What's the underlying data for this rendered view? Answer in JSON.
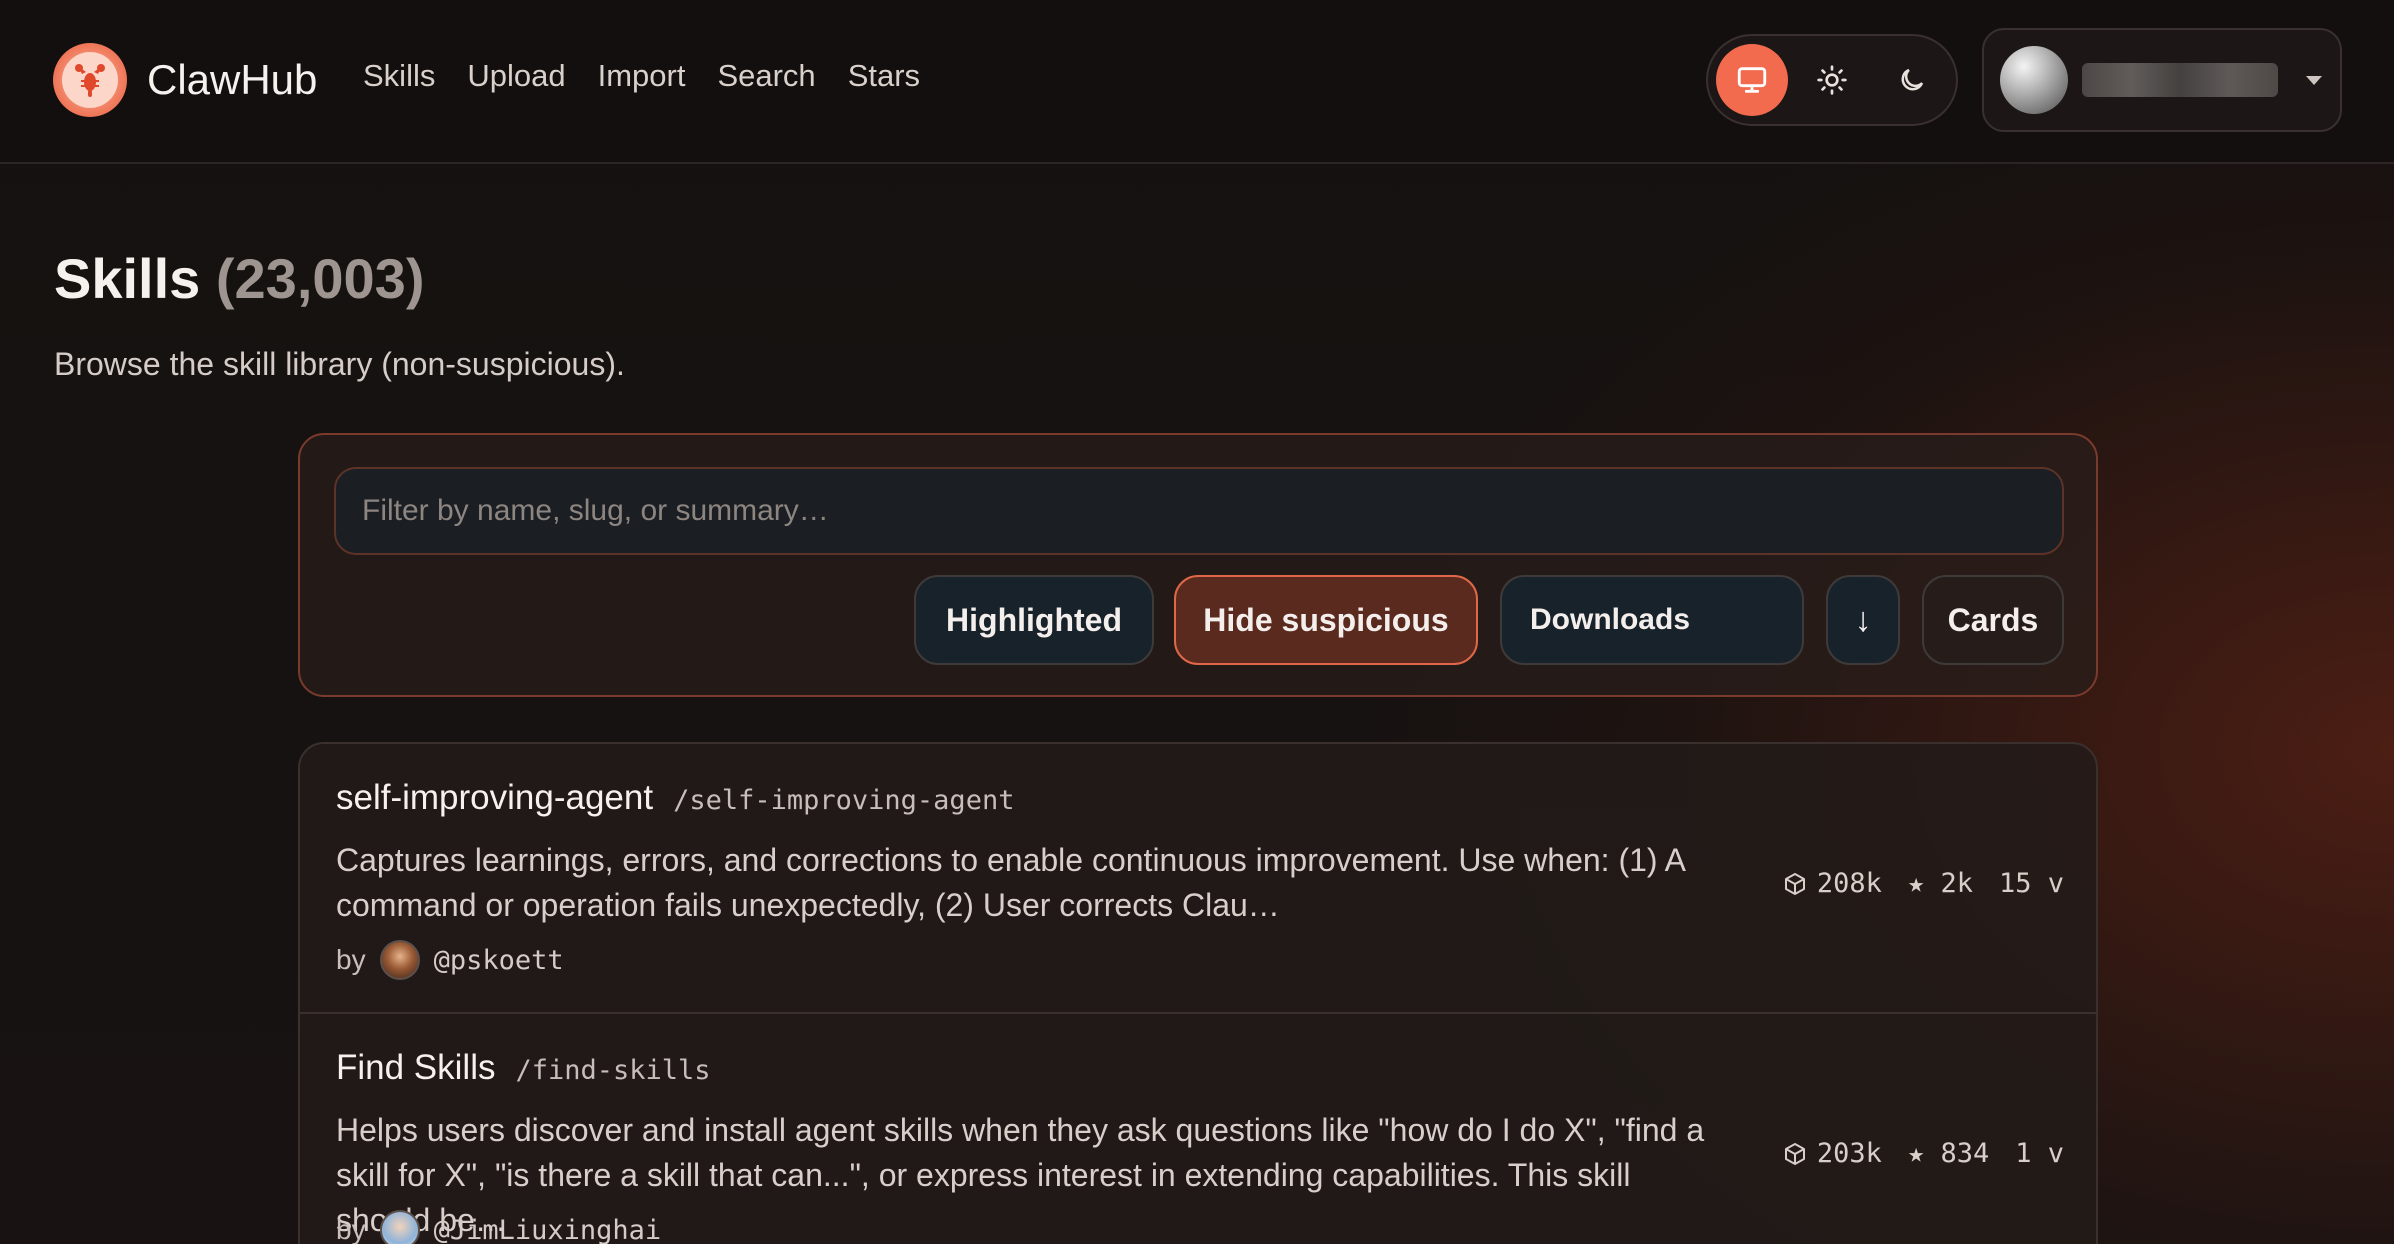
{
  "header": {
    "brand": "ClawHub",
    "nav": [
      "Skills",
      "Upload",
      "Import",
      "Search",
      "Stars"
    ],
    "theme_options": [
      "monitor-icon",
      "sun-icon",
      "moon-icon"
    ],
    "theme_active": "system"
  },
  "page": {
    "title": "Skills",
    "count": "(23,003)",
    "subtitle": "Browse the skill library (non-suspicious)."
  },
  "filters": {
    "placeholder": "Filter by name, slug, or summary…",
    "highlighted_label": "Highlighted",
    "hide_suspicious_label": "Hide suspicious",
    "sort_label": "Downloads",
    "sort_direction": "↓",
    "view_label": "Cards"
  },
  "skills": [
    {
      "name": "self-improving-agent",
      "slug": "/self-improving-agent",
      "summary": "Captures learnings, errors, and corrections to enable continuous improvement. Use when: (1) A command or operation fails unexpectedly, (2) User corrects Clau…",
      "by": "by",
      "author": "@pskoett",
      "downloads": "208k",
      "stars": "★ 2k",
      "versions": "15 v"
    },
    {
      "name": "Find Skills",
      "slug": "/find-skills",
      "summary": "Helps users discover and install agent skills when they ask questions like \"how do I do X\", \"find a skill for X\", \"is there a skill that can...\", or express interest in extending capabilities. This skill should be…",
      "by": "by",
      "author": "@JimLiuxinghai",
      "downloads": "203k",
      "stars": "★ 834",
      "versions": "1 v"
    }
  ],
  "colors": {
    "accent": "#f26b4f",
    "background": "#141110",
    "panel_border": "#7a3a2c"
  }
}
